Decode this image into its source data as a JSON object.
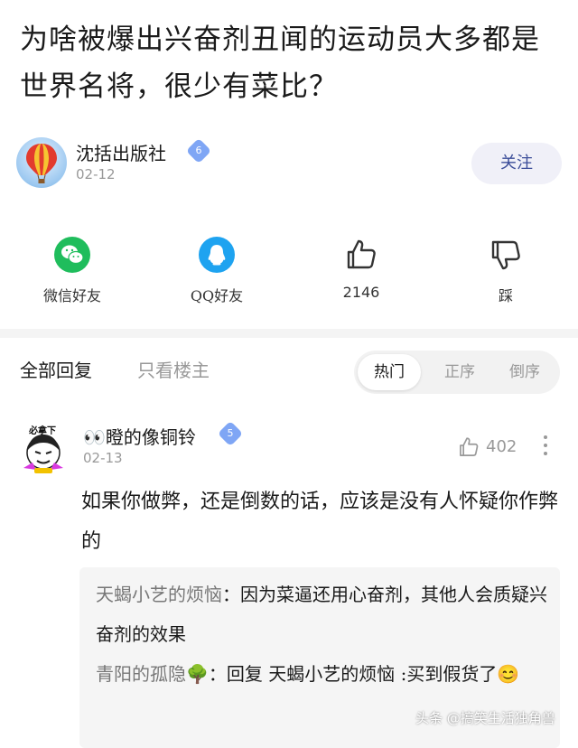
{
  "post": {
    "title": "为啥被爆出兴奋剂丑闻的运动员大多都是世界名将，很少有菜比？"
  },
  "author": {
    "name": "沈括出版社",
    "level": "6",
    "date": "02-12",
    "follow_label": "关注"
  },
  "share": {
    "wechat_label": "微信好友",
    "qq_label": "QQ好友",
    "like_count": "2146",
    "dislike_label": "踩"
  },
  "tabs": {
    "all_replies": "全部回复",
    "owner_only": "只看楼主",
    "sort_hot": "热门",
    "sort_asc": "正序",
    "sort_desc": "倒序"
  },
  "comment": {
    "avatar_text": "必拿下",
    "name": "👀瞪的像铜铃",
    "level": "5",
    "date": "02-13",
    "like_count": "402",
    "body": "如果你做弊，还是倒数的话，应该是没有人怀疑你作弊的",
    "replies": [
      {
        "user": "天蝎小艺的烦恼",
        "sep": "：",
        "text": "因为菜逼还用心奋剂，其他人会质疑兴奋剂的效果"
      },
      {
        "user": "青阳的孤隐🌳",
        "sep": "：",
        "text": "回复 天蝎小艺的烦恼 :买到假货了😊"
      }
    ]
  },
  "watermark": "头条 @搞笑生活独角兽",
  "colors": {
    "accent": "#3b4d99",
    "wechat": "#1fbd5c",
    "qq": "#1ea3f0",
    "badge": "#7fa6f5"
  }
}
